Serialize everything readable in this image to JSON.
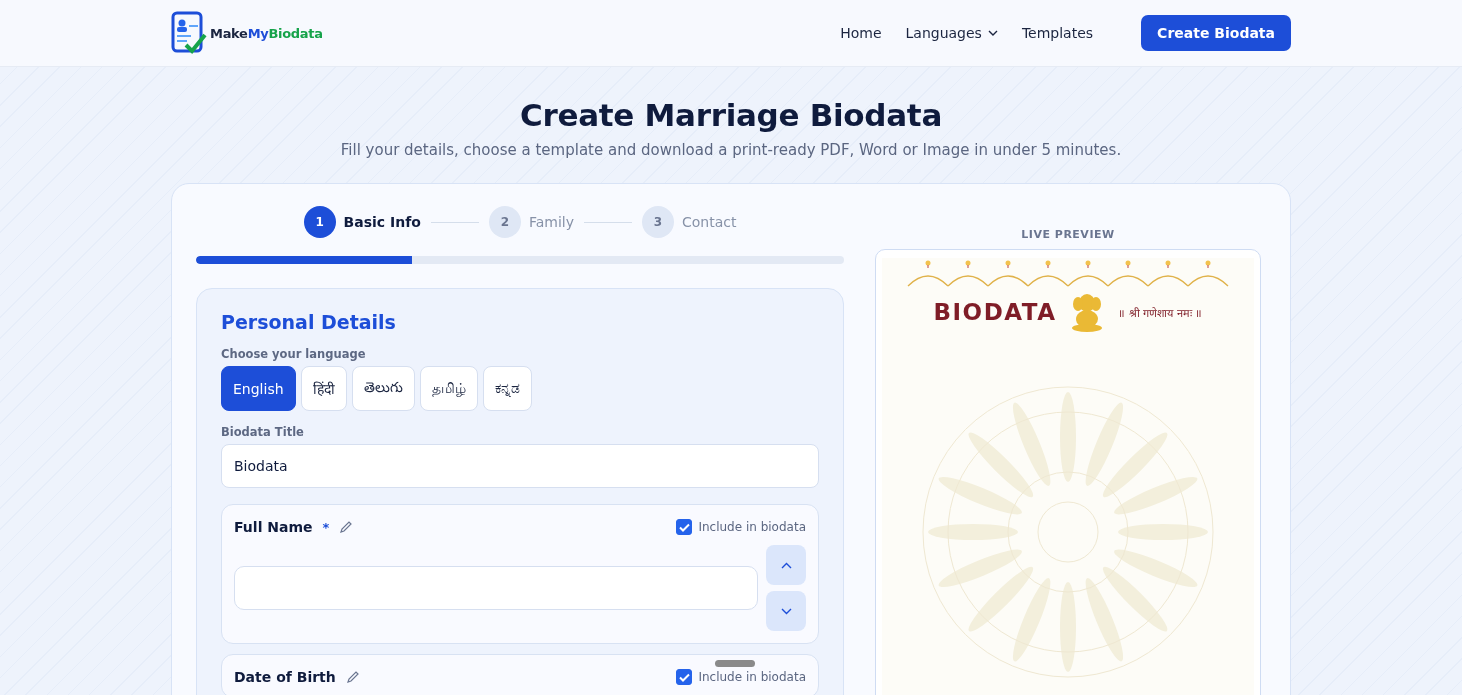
{
  "header": {
    "logo": {
      "part1": "Make",
      "part2": "My",
      "part3": "Biodata"
    },
    "nav": [
      {
        "label": "Home",
        "kind": "link"
      },
      {
        "label": "Languages",
        "kind": "dropdown"
      },
      {
        "label": "Templates",
        "kind": "link"
      }
    ],
    "cta": "Create Biodata"
  },
  "hero": {
    "title": "Create Marriage Biodata",
    "subtitle": "Fill your details, choose a template and download a print-ready PDF, Word or Image in under 5 minutes."
  },
  "steps": [
    {
      "number": "1",
      "label": "Basic Info",
      "selected": true
    },
    {
      "number": "2",
      "label": "Family",
      "selected": false
    },
    {
      "number": "3",
      "label": "Contact",
      "selected": false
    }
  ],
  "progress": {
    "level": 0.333
  },
  "form": {
    "title": "Personal Details",
    "language_label": "Choose your language",
    "languages": [
      {
        "label": "English",
        "selected": true
      },
      {
        "label": "हिंदी",
        "selected": false
      },
      {
        "label": "తెలుగు",
        "selected": false
      },
      {
        "label": "தமிழ்",
        "selected": false
      },
      {
        "label": "ಕನ್ನಡ",
        "selected": false
      }
    ],
    "title_label": "Biodata Title",
    "title_value": "Biodata",
    "fields": [
      {
        "label": "Full Name",
        "required_mark": "*",
        "include_label": "Include in biodata",
        "included": true
      },
      {
        "label": "Date of Birth",
        "include_label": "Include in biodata",
        "included": true
      }
    ]
  },
  "preview": {
    "label": "LIVE PREVIEW",
    "heading": "BIODATA",
    "invocation": "॥ श्री गणेशाय नमः ॥"
  }
}
